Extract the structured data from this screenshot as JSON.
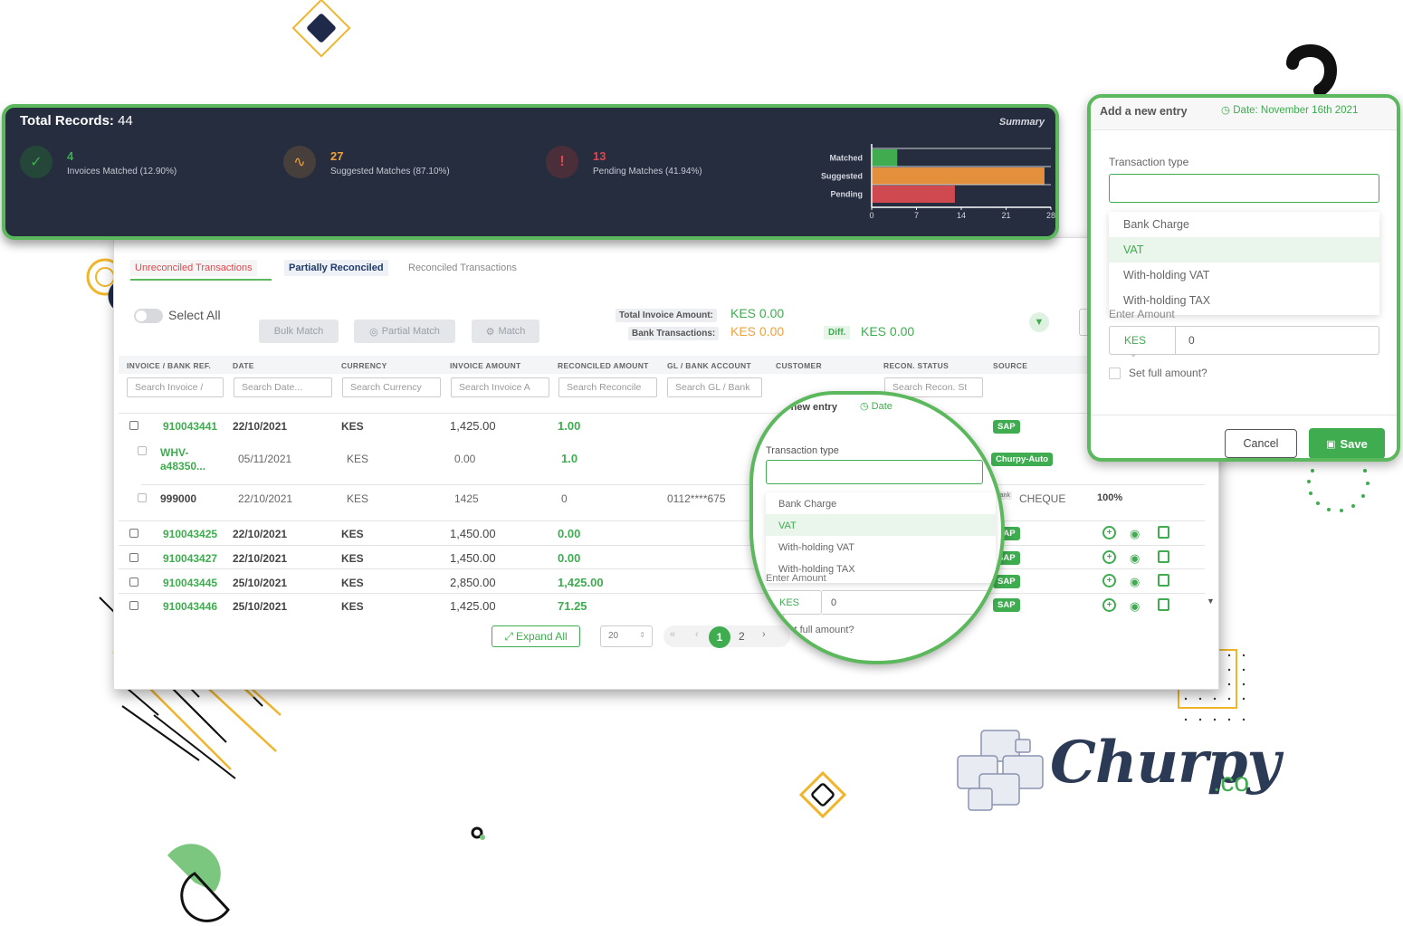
{
  "summary": {
    "title": "Total Records:",
    "total": "44",
    "label": "Summary",
    "stats": [
      {
        "num": "4",
        "label": "Invoices Matched (12.90%)",
        "color": "#3eac4f"
      },
      {
        "num": "27",
        "label": "Suggested Matches (87.10%)",
        "color": "#f0a13a"
      },
      {
        "num": "13",
        "label": "Pending Matches (41.94%)",
        "color": "#e0474c"
      }
    ]
  },
  "chart_data": {
    "type": "bar",
    "orientation": "horizontal",
    "categories": [
      "Matched",
      "Suggested",
      "Pending"
    ],
    "values": [
      4,
      27,
      13
    ],
    "colors": [
      "#3eac4f",
      "#e48f3b",
      "#cf4a50"
    ],
    "xticks": [
      "0",
      "7",
      "14",
      "21",
      "28"
    ],
    "xlim": [
      0,
      28
    ]
  },
  "tabs": [
    "Unreconciled Transactions",
    "Partially Reconciled",
    "Reconciled Transactions"
  ],
  "toolbar": {
    "select_all": "Select All",
    "bulk_match": "Bulk Match",
    "partial_match": "Partial Match",
    "match": "Match",
    "total_invoice_label": "Total Invoice Amount:",
    "total_invoice_value": "KES 0.00",
    "bank_tx_label": "Bank Transactions:",
    "bank_tx_value": "KES 0.00",
    "diff_label": "Diff.",
    "diff_value": "KES 0.00"
  },
  "table": {
    "headers": [
      "INVOICE / BANK REF.",
      "DATE",
      "CURRENCY",
      "INVOICE AMOUNT",
      "RECONCILED AMOUNT",
      "GL / BANK ACCOUNT",
      "CUSTOMER",
      "RECON. STATUS",
      "SOURCE"
    ],
    "filters": [
      "Search Invoice /",
      "Search Date...",
      "Search Currency",
      "Search Invoice A",
      "Search Reconcile",
      "Search GL / Bank",
      "",
      "Search Recon. St"
    ],
    "rows": [
      {
        "ref": "910043441",
        "date": "22/10/2021",
        "cur": "KES",
        "inv": "1,425.00",
        "rec": "1.00"
      },
      {
        "ref": "WHV-a48350...",
        "date": "05/11/2021",
        "cur": "KES",
        "inv": "0.00",
        "rec": "1.0"
      },
      {
        "ref": "999000",
        "date": "22/10/2021",
        "cur": "KES",
        "inv": "1425",
        "rec": "0",
        "gl": "0112****675",
        "source": "CHEQUE",
        "pct": "100%",
        "bank_tag": "Bank"
      },
      {
        "ref": "910043425",
        "date": "22/10/2021",
        "cur": "KES",
        "inv": "1,450.00",
        "rec": "0.00"
      },
      {
        "ref": "910043427",
        "date": "22/10/2021",
        "cur": "KES",
        "inv": "1,450.00",
        "rec": "0.00"
      },
      {
        "ref": "910043445",
        "date": "25/10/2021",
        "cur": "KES",
        "inv": "2,850.00",
        "rec": "1,425.00"
      },
      {
        "ref": "910043446",
        "date": "25/10/2021",
        "cur": "KES",
        "inv": "1,425.00",
        "rec": "71.25"
      }
    ],
    "badges": {
      "sap": "SAP",
      "churpy_auto": "Churpy-Auto"
    }
  },
  "pagination": {
    "expand_all": "Expand All",
    "page_size": "20",
    "pages": [
      "1",
      "2"
    ],
    "prev": "‹",
    "first": "«",
    "next": "›"
  },
  "modal": {
    "title": "Add a new entry",
    "date": "Date: November 16th 2021",
    "transaction_type_label": "Transaction type",
    "options": [
      "Bank Charge",
      "VAT",
      "With-holding VAT",
      "With-holding TAX"
    ],
    "selected": "VAT",
    "amount_label": "Enter Amount",
    "currency": "KES",
    "amount_value": "0",
    "full_amount": "Set full amount?",
    "cancel": "Cancel",
    "save": "Save"
  },
  "zoom": {
    "title": "Add a new entry",
    "date_short": "Date",
    "transaction_type_label": "Transaction type",
    "options": [
      "Bank Charge",
      "VAT",
      "With-holding VAT",
      "With-holding TAX"
    ],
    "amount_label": "Enter Amount",
    "currency": "KES",
    "amount_value": "0",
    "full_amount": "Set full amount?"
  },
  "logo": {
    "name": "Churpy",
    "suffix": ".co"
  }
}
